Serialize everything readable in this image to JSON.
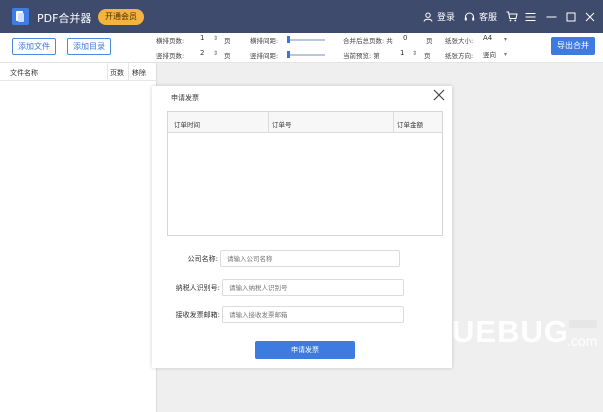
{
  "titlebar": {
    "app_title": "PDF合并器",
    "vip_button": "开通会员",
    "login": "登录",
    "service": "客服"
  },
  "toolbar": {
    "add_file": "添加文件",
    "add_folder": "添加目录",
    "h_pages_label": "横排页数:",
    "h_pages_value": "1",
    "v_pages_label": "竖排页数:",
    "v_pages_value": "2",
    "unit_page": "页",
    "h_spacing_label": "横排间距:",
    "v_spacing_label": "竖排间距:",
    "merged_total_label": "合并后总页数: 共",
    "merged_total_value": "0",
    "preview_label": "当前预览: 第",
    "preview_value": "1",
    "paper_size_label": "纸张大小:",
    "paper_size_value": "A4",
    "orientation_label": "纸张方向:",
    "orientation_value": "竖向",
    "export_button": "导出合并"
  },
  "file_list": {
    "col_name": "文件名称",
    "col_pages": "页数",
    "col_remove": "移除"
  },
  "dialog": {
    "title": "申请发票",
    "table_headers": [
      "订单时间",
      "订单号",
      "订单金额"
    ],
    "company_label": "公司名称:",
    "company_placeholder": "请输入公司名称",
    "taxid_label": "纳税人识别号:",
    "taxid_placeholder": "请输入纳税人识别号",
    "email_label": "接收发票邮箱:",
    "email_placeholder": "请输入接收发票邮箱",
    "submit_button": "申请发票"
  },
  "watermark": {
    "text": "UEBUG",
    "suffix": ".com"
  },
  "colors": {
    "titlebar": "#3f4b6c",
    "accent": "#3d7be0",
    "vip": "#f2b43f"
  }
}
